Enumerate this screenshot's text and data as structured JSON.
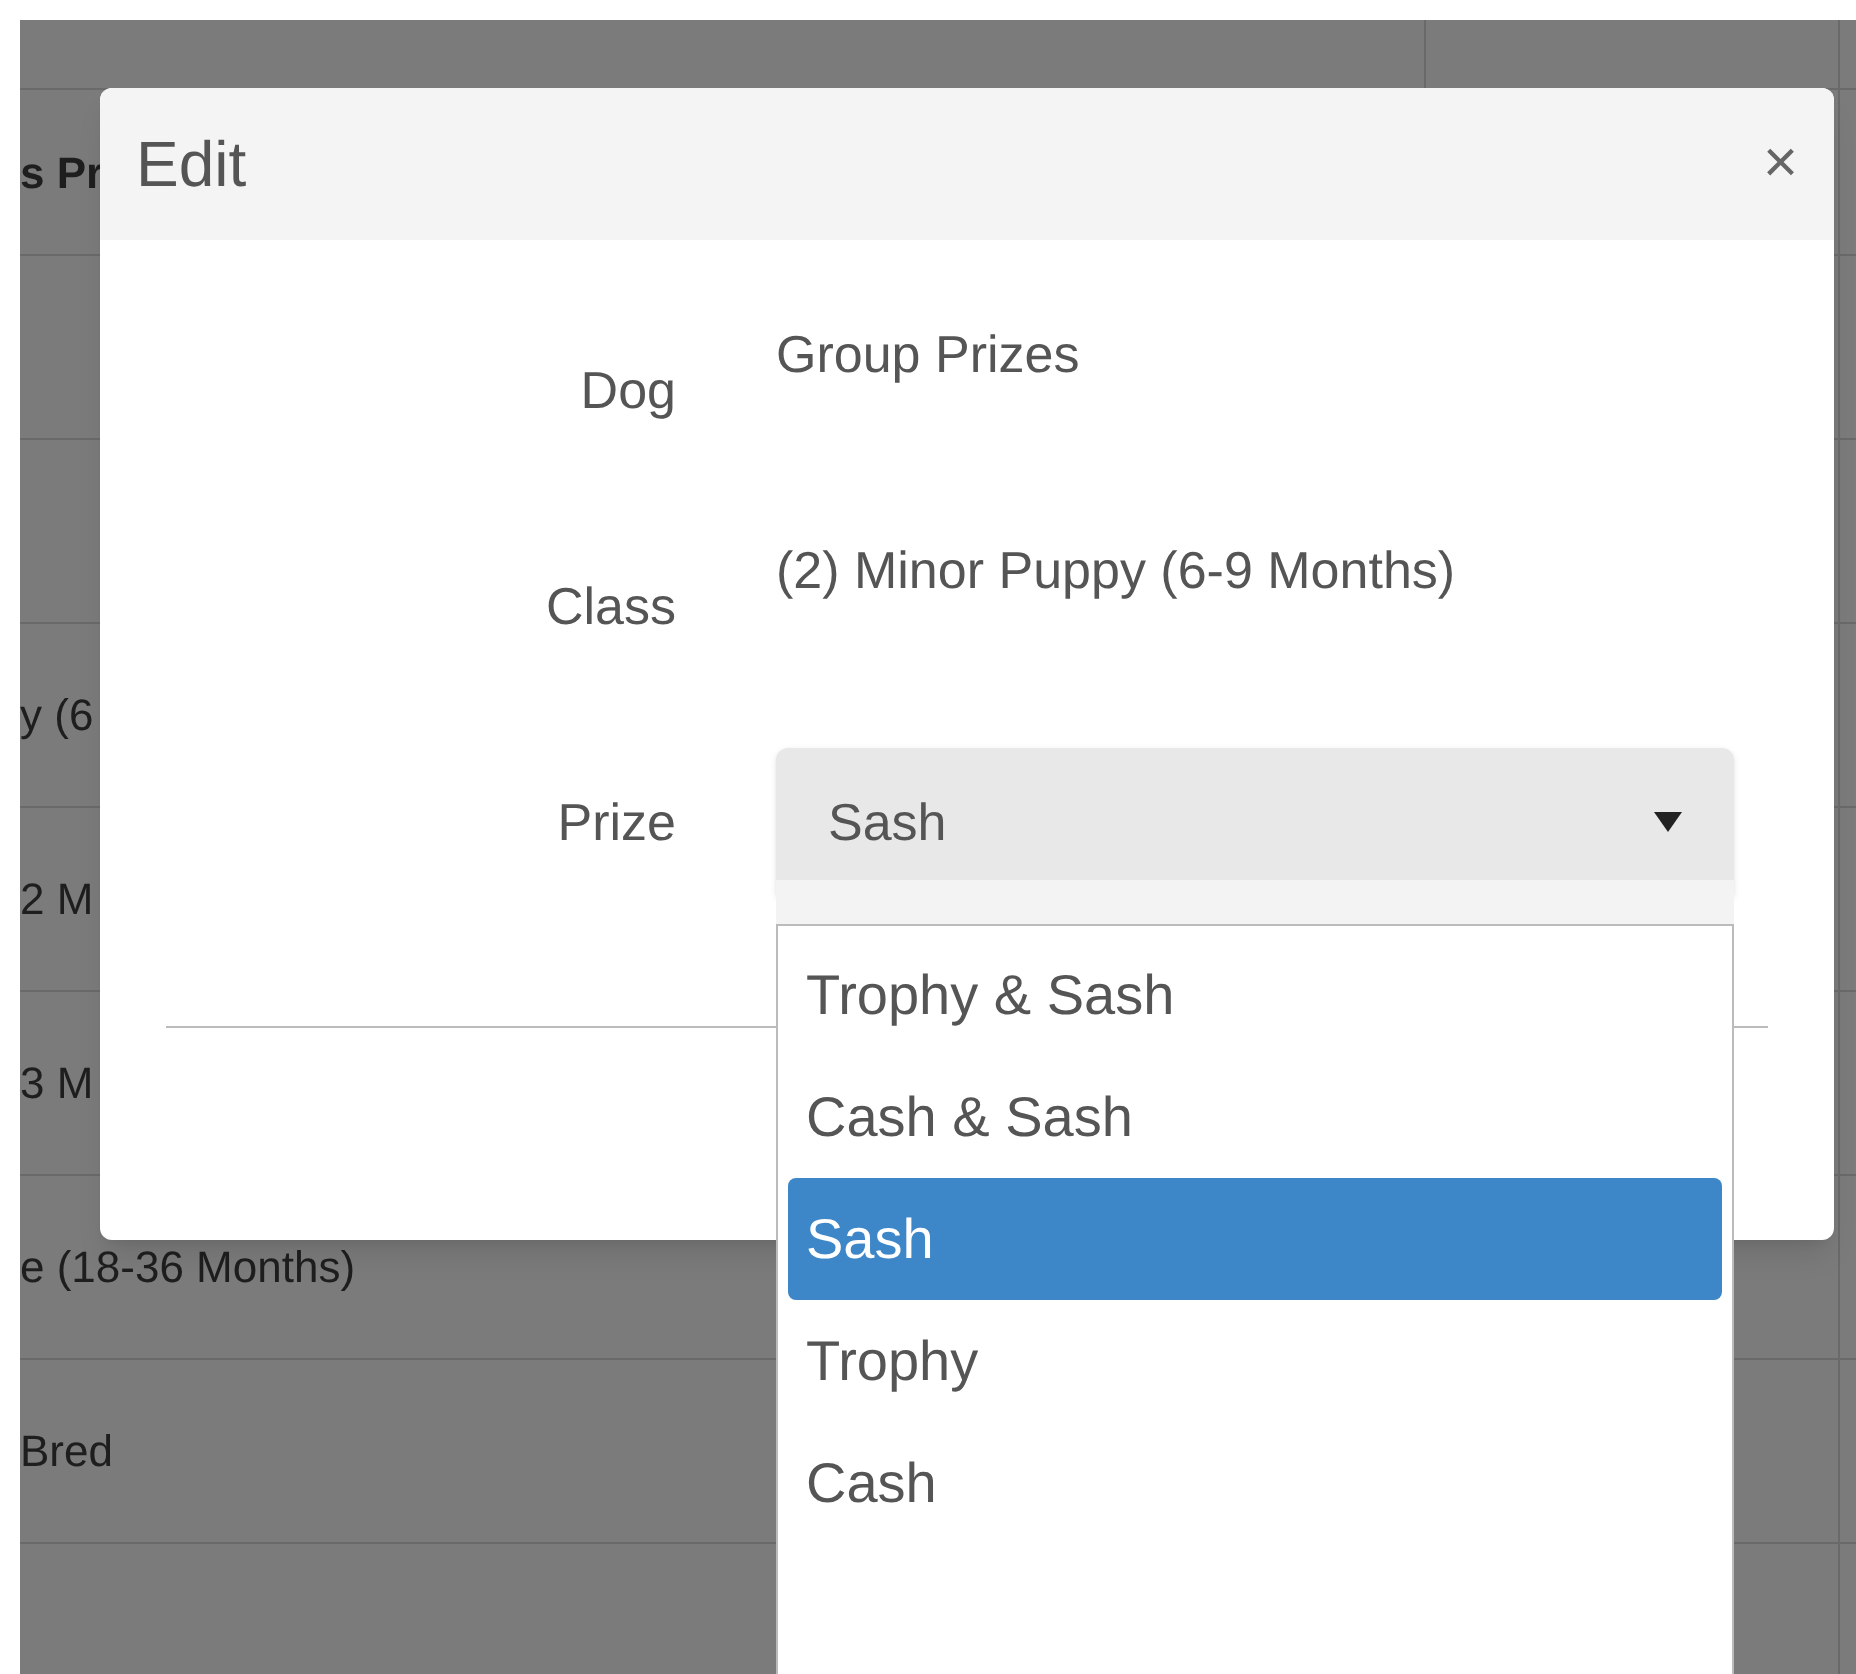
{
  "background_table": {
    "rows": [
      {
        "kind": "top"
      },
      {
        "kind": "header",
        "text": "s Pr"
      },
      {
        "kind": "row"
      },
      {
        "kind": "row"
      },
      {
        "kind": "row",
        "text": "y (6"
      },
      {
        "kind": "row",
        "text": "2 M"
      },
      {
        "kind": "row",
        "text": "3 M"
      },
      {
        "kind": "row",
        "text": "e (18-36 Months)"
      },
      {
        "kind": "row",
        "text": "Bred"
      },
      {
        "kind": "row"
      }
    ]
  },
  "dialog": {
    "title": "Edit",
    "close": "×",
    "fields": [
      {
        "label": "Dog",
        "value": "Group Prizes"
      },
      {
        "label": "Class",
        "value": "(2) Minor Puppy (6-9 Months)"
      }
    ],
    "prize": {
      "label": "Prize",
      "value": "Sash"
    },
    "options": [
      {
        "label": "Trophy & Sash",
        "selected": false
      },
      {
        "label": "Cash & Sash",
        "selected": false
      },
      {
        "label": "Sash",
        "selected": true
      },
      {
        "label": "Trophy",
        "selected": false
      },
      {
        "label": "Cash",
        "selected": false
      }
    ]
  }
}
